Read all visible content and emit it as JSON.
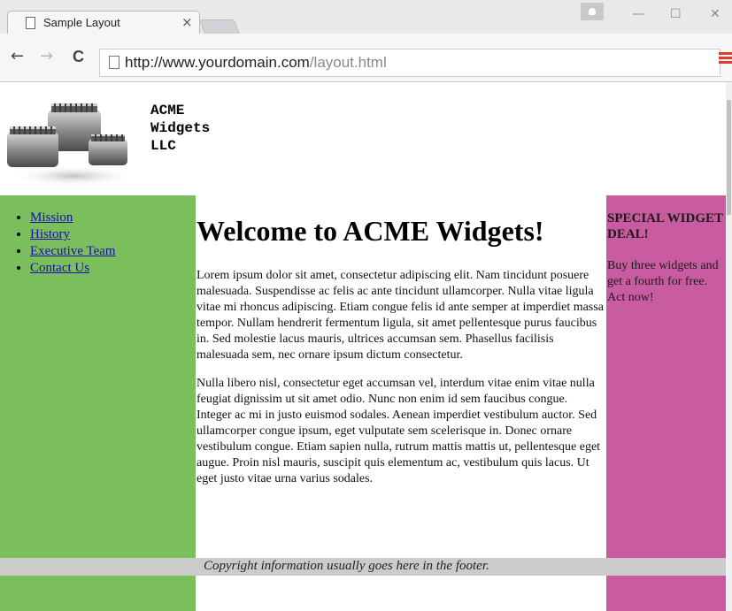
{
  "browser": {
    "tab_title": "Sample Layout",
    "tab_close": "×",
    "window_controls": {
      "minimize": "—",
      "maximize": "☐",
      "close": "✕"
    },
    "nav": {
      "back": "←",
      "forward": "→",
      "reload": "C"
    },
    "address": {
      "host": "http://www.yourdomain.com",
      "path": "/layout.html"
    }
  },
  "site": {
    "title_lines": [
      "ACME",
      "Widgets",
      "LLC"
    ]
  },
  "nav_links": [
    "Mission",
    "History",
    "Executive Team",
    "Contact Us"
  ],
  "main": {
    "heading": "Welcome to ACME Widgets!",
    "paragraphs": [
      "Lorem ipsum dolor sit amet, consectetur adipiscing elit. Nam tincidunt posuere malesuada. Suspendisse ac felis ac ante tincidunt ullamcorper. Nulla vitae ligula vitae mi rhoncus adipiscing. Etiam congue felis id ante semper at imperdiet massa tempor. Nullam hendrerit fermentum ligula, sit amet pellentesque purus faucibus in. Sed molestie lacus mauris, ultrices accumsan sem. Phasellus facilisis malesuada sem, nec ornare ipsum dictum consectetur.",
      "Nulla libero nisl, consectetur eget accumsan vel, interdum vitae enim vitae nulla feugiat dignissim ut sit amet odio. Nunc non enim id sem faucibus congue. Integer ac mi in justo euismod sodales. Aenean imperdiet vestibulum auctor. Sed ullamcorper congue ipsum, eget vulputate sem scelerisque in. Donec ornare vestibulum congue. Etiam sapien nulla, rutrum mattis mattis ut, pellentesque eget augue. Proin nisl mauris, suscipit quis elementum ac, vestibulum quis lacus. Ut eget justo vitae urna varius sodales."
    ]
  },
  "sidebar_right": {
    "title": "SPECIAL WIDGET DEAL!",
    "text": "Buy three widgets and get a fourth for free. Act now!"
  },
  "footer": {
    "text": "Copyright information usually goes here in the footer."
  },
  "colors": {
    "left_column": "#7bbf5c",
    "right_column": "#c95ba0",
    "footer": "#cbcbcb",
    "link": "#1a0dab"
  }
}
